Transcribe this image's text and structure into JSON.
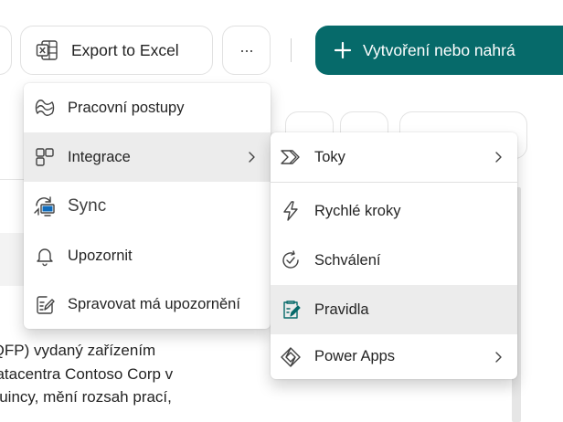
{
  "toolbar": {
    "export_label": "Export to Excel",
    "more_label": "···",
    "create_label": "Vytvoření nebo nahrá",
    "brand_color": "#066a6a"
  },
  "main_menu": {
    "items": [
      {
        "label": "Pracovní postupy",
        "icon": "workflow-icon"
      },
      {
        "label": "Integrace",
        "icon": "integration-icon",
        "has_submenu": true,
        "highlighted": true
      },
      {
        "label": "Sync",
        "icon": "sync-icon"
      },
      {
        "label": "Upozornit",
        "icon": "bell-icon"
      },
      {
        "label": "Spravovat má upozornění",
        "icon": "manage-alerts-icon"
      }
    ]
  },
  "sub_menu": {
    "items": [
      {
        "label": "Toky",
        "icon": "flow-icon",
        "has_submenu": true
      },
      {
        "label": "Rychlé kroky",
        "icon": "lightning-icon"
      },
      {
        "label": "Schválení",
        "icon": "approval-icon"
      },
      {
        "label": "Pravidla",
        "icon": "rules-icon",
        "highlighted": true
      },
      {
        "label": "Power Apps",
        "icon": "power-apps-icon",
        "has_submenu": true
      }
    ]
  },
  "background": {
    "text_lines": [
      "(QFP) vydaný zařízením",
      "datacentra Contoso Corp v",
      "Quincy, mění rozsah prací,"
    ]
  }
}
